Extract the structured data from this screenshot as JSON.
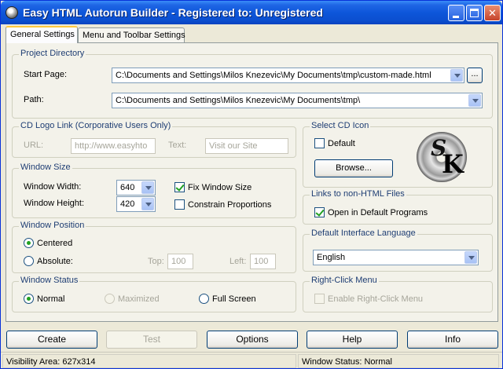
{
  "window": {
    "title": "Easy HTML Autorun Builder - Registered to: Unregistered"
  },
  "tabs": [
    {
      "label": "General Settings",
      "active": true
    },
    {
      "label": "Menu and Toolbar Settings",
      "active": false
    }
  ],
  "project_directory": {
    "title": "Project Directory",
    "start_page_label": "Start Page:",
    "start_page_value": "C:\\Documents and Settings\\Milos Knezevic\\My Documents\\tmp\\custom-made.html",
    "browse_label": "...",
    "path_label": "Path:",
    "path_value": "C:\\Documents and Settings\\Milos Knezevic\\My Documents\\tmp\\"
  },
  "cd_logo_link": {
    "title": "CD Logo Link (Corporative Users Only)",
    "url_label": "URL:",
    "url_value": "http://www.easyhto",
    "text_label": "Text:",
    "text_value": "Visit our Site"
  },
  "window_size": {
    "title": "Window Size",
    "width_label": "Window Width:",
    "width_value": "640",
    "height_label": "Window Height:",
    "height_value": "420",
    "fix_label": "Fix Window Size",
    "fix_checked": true,
    "constrain_label": "Constrain Proportions",
    "constrain_checked": false
  },
  "window_position": {
    "title": "Window Position",
    "centered_label": "Centered",
    "absolute_label": "Absolute:",
    "selected": "Centered",
    "top_label": "Top:",
    "top_value": "100",
    "left_label": "Left:",
    "left_value": "100"
  },
  "window_status": {
    "title": "Window Status",
    "normal_label": "Normal",
    "maximized_label": "Maximized",
    "fullscreen_label": "Full Screen",
    "selected": "Normal"
  },
  "cd_icon": {
    "title": "Select CD Icon",
    "default_label": "Default",
    "default_checked": false,
    "browse_label": "Browse..."
  },
  "links_non_html": {
    "title": "Links to non-HTML Files",
    "open_label": "Open in Default Programs",
    "open_checked": true
  },
  "language": {
    "title": "Default Interface Language",
    "value": "English"
  },
  "right_click": {
    "title": "Right-Click Menu",
    "enable_label": "Enable Right-Click Menu",
    "enable_checked": false
  },
  "actions": {
    "create": "Create",
    "test": "Test",
    "options": "Options",
    "help": "Help",
    "info": "Info"
  },
  "status_bar": {
    "visibility": "Visibility Area: 627x314",
    "window_status": "Window Status: Normal"
  }
}
